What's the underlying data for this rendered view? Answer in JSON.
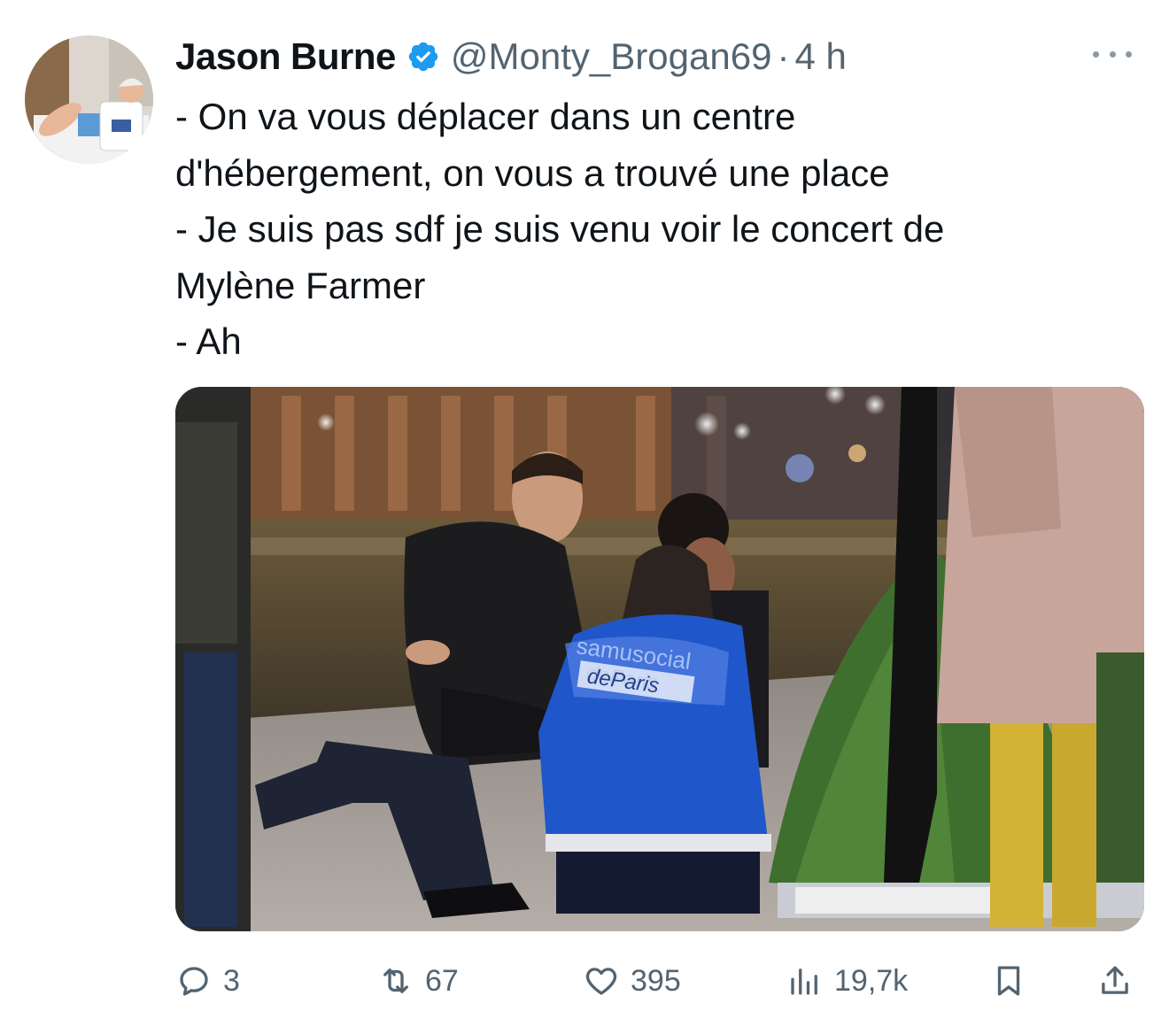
{
  "tweet": {
    "display_name": "Jason Burne",
    "handle": "@Monty_Brogan69",
    "separator": "·",
    "time": "4 h",
    "text_lines": [
      "- On va vous déplacer dans un centre",
      "d'hébergement, on vous a trouvé une place",
      "- Je suis pas sdf je suis venu voir le concert de",
      "Mylène Farmer",
      "- Ah"
    ],
    "media": {
      "vest_text_1": "samusocial",
      "vest_text_2": "deParis"
    },
    "actions": {
      "replies": "3",
      "reposts": "67",
      "likes": "395",
      "views": "19,7k"
    }
  },
  "colors": {
    "text": "#0f1419",
    "secondary": "#536471",
    "verified": "#1d9bf0"
  },
  "icons": [
    "verified-badge-icon",
    "more-icon",
    "reply-icon",
    "repost-icon",
    "like-icon",
    "views-icon",
    "bookmark-icon",
    "share-icon"
  ]
}
